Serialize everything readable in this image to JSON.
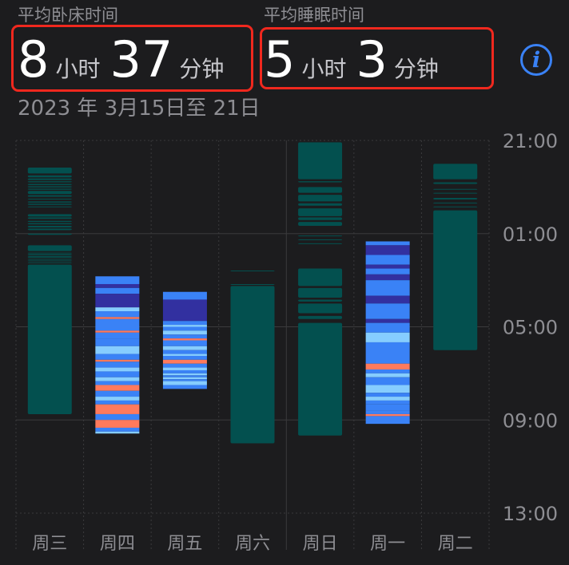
{
  "summary": {
    "in_bed": {
      "label": "平均卧床时间",
      "hours": "8",
      "hours_unit": "小时",
      "minutes": "37",
      "minutes_unit": "分钟"
    },
    "asleep": {
      "label": "平均睡眠时间",
      "hours": "5",
      "hours_unit": "小时",
      "minutes": "3",
      "minutes_unit": "分钟"
    },
    "date_range": "2023 年 3月15日至 21日"
  },
  "colors": {
    "background": "#1c1c1e",
    "grid": "#3a3a3c",
    "in_bed": "#03504f",
    "highlight_box": "#f0281e",
    "info": "#3a82f6",
    "deep": "#3230a0",
    "core": "#3a82f6",
    "rem": "#86cdff",
    "awake": "#ff7a5c"
  },
  "icons": {
    "info": "info-icon"
  },
  "chart_data": {
    "type": "bar",
    "title": "",
    "xlabel": "",
    "ylabel": "",
    "categories": [
      "周三",
      "周四",
      "周五",
      "周六",
      "周日",
      "周一",
      "周二"
    ],
    "y_ticks": [
      "21:00",
      "01:00",
      "05:00",
      "09:00",
      "13:00"
    ],
    "ylim": [
      "21:00",
      "13:00"
    ],
    "grid": true,
    "legend": "none",
    "series": [
      {
        "kind": "in_bed",
        "values": [
          [
            [
              "22:10",
              "22:25"
            ],
            [
              "22:30",
              "22:35"
            ],
            [
              "22:38",
              "22:42"
            ],
            [
              "22:45",
              "22:48"
            ],
            [
              "22:52",
              "22:55"
            ],
            [
              "22:58",
              "23:01"
            ],
            [
              "23:04",
              "23:07"
            ],
            [
              "23:10",
              "23:18"
            ],
            [
              "23:21",
              "23:25"
            ],
            [
              "23:30",
              "23:32"
            ],
            [
              "23:37",
              "23:40"
            ],
            [
              "23:43",
              "23:46"
            ],
            [
              "23:50",
              "23:52"
            ],
            [
              "00:10",
              "00:16"
            ],
            [
              "00:18",
              "00:22"
            ],
            [
              "00:27",
              "00:30"
            ],
            [
              "00:33",
              "00:36"
            ],
            [
              "00:40",
              "00:44"
            ],
            [
              "00:47",
              "00:51"
            ],
            [
              "01:00",
              "01:03"
            ],
            [
              "01:30",
              "01:45"
            ],
            [
              "01:49",
              "01:51"
            ],
            [
              "01:53",
              "01:56"
            ],
            [
              "01:58",
              "02:02"
            ],
            [
              "02:05",
              "02:07"
            ],
            [
              "02:09",
              "02:11"
            ],
            [
              "02:14",
              "02:16"
            ],
            [
              "02:20",
              "08:45"
            ]
          ],
          [],
          [],
          [
            [
              "02:35",
              "02:36"
            ],
            [
              "03:10",
              "03:12"
            ],
            [
              "03:15",
              "10:00"
            ]
          ],
          [
            [
              "21:05",
              "22:40"
            ],
            [
              "22:45",
              "22:48"
            ],
            [
              "23:00",
              "23:15"
            ],
            [
              "23:20",
              "23:37"
            ],
            [
              "23:42",
              "23:48"
            ],
            [
              "23:55",
              "00:15"
            ],
            [
              "00:18",
              "00:25"
            ],
            [
              "00:30",
              "00:40"
            ],
            [
              "01:05",
              "01:07"
            ],
            [
              "01:15",
              "01:17"
            ],
            [
              "01:25",
              "01:27"
            ],
            [
              "02:30",
              "03:15"
            ],
            [
              "03:20",
              "03:45"
            ],
            [
              "03:50",
              "03:55"
            ],
            [
              "04:00",
              "04:25"
            ],
            [
              "04:32",
              "04:40"
            ],
            [
              "04:50",
              "09:40"
            ]
          ],
          [],
          [
            [
              "22:00",
              "22:40"
            ],
            [
              "22:48",
              "22:52"
            ],
            [
              "23:05",
              "23:07"
            ],
            [
              "23:15",
              "23:17"
            ],
            [
              "23:28",
              "23:32"
            ],
            [
              "23:40",
              "23:42"
            ],
            [
              "23:50",
              "23:52"
            ],
            [
              "00:00",
              "06:00"
            ]
          ]
        ]
      },
      {
        "kind": "stages",
        "values": [
          [],
          [
            [
              "02:50",
              "03:10",
              "core"
            ],
            [
              "03:10",
              "03:20",
              "deep"
            ],
            [
              "03:20",
              "03:35",
              "core"
            ],
            [
              "03:35",
              "04:10",
              "deep"
            ],
            [
              "04:10",
              "04:20",
              "rem"
            ],
            [
              "04:20",
              "04:35",
              "core"
            ],
            [
              "04:35",
              "04:40",
              "awake"
            ],
            [
              "04:40",
              "05:10",
              "core"
            ],
            [
              "05:10",
              "05:15",
              "awake"
            ],
            [
              "05:15",
              "05:30",
              "core"
            ],
            [
              "05:30",
              "05:50",
              "core"
            ],
            [
              "05:50",
              "06:10",
              "rem"
            ],
            [
              "06:10",
              "06:25",
              "core"
            ],
            [
              "06:25",
              "06:30",
              "awake"
            ],
            [
              "06:30",
              "06:45",
              "core"
            ],
            [
              "06:45",
              "06:55",
              "rem"
            ],
            [
              "06:55",
              "07:10",
              "core"
            ],
            [
              "07:10",
              "07:20",
              "rem"
            ],
            [
              "07:20",
              "07:30",
              "core"
            ],
            [
              "07:30",
              "07:45",
              "awake"
            ],
            [
              "07:45",
              "08:00",
              "core"
            ],
            [
              "08:00",
              "08:10",
              "rem"
            ],
            [
              "08:10",
              "08:20",
              "core"
            ],
            [
              "08:20",
              "08:45",
              "awake"
            ],
            [
              "08:45",
              "09:00",
              "core"
            ],
            [
              "09:00",
              "09:20",
              "awake"
            ],
            [
              "09:20",
              "09:30",
              "core"
            ],
            [
              "09:30",
              "09:35",
              "rem"
            ]
          ],
          [
            [
              "03:30",
              "03:50",
              "core"
            ],
            [
              "03:50",
              "04:45",
              "deep"
            ],
            [
              "04:45",
              "04:55",
              "core"
            ],
            [
              "04:55",
              "05:00",
              "rem"
            ],
            [
              "05:00",
              "05:10",
              "core"
            ],
            [
              "05:10",
              "05:20",
              "rem"
            ],
            [
              "05:20",
              "05:30",
              "core"
            ],
            [
              "05:30",
              "05:35",
              "awake"
            ],
            [
              "05:35",
              "05:50",
              "core"
            ],
            [
              "05:50",
              "06:00",
              "rem"
            ],
            [
              "06:00",
              "06:10",
              "core"
            ],
            [
              "06:10",
              "06:15",
              "rem"
            ],
            [
              "06:15",
              "06:25",
              "core"
            ],
            [
              "06:25",
              "06:35",
              "awake"
            ],
            [
              "06:35",
              "06:45",
              "core"
            ],
            [
              "06:45",
              "06:52",
              "rem"
            ],
            [
              "06:52",
              "07:00",
              "core"
            ],
            [
              "07:00",
              "07:05",
              "rem"
            ],
            [
              "07:05",
              "07:10",
              "core"
            ],
            [
              "07:10",
              "07:15",
              "rem"
            ],
            [
              "07:15",
              "07:20",
              "core"
            ],
            [
              "07:20",
              "07:30",
              "rem"
            ],
            [
              "07:30",
              "07:40",
              "core"
            ]
          ],
          [],
          [],
          [
            [
              "01:20",
              "01:30",
              "core"
            ],
            [
              "01:30",
              "01:55",
              "deep"
            ],
            [
              "01:55",
              "02:20",
              "core"
            ],
            [
              "02:20",
              "02:30",
              "deep"
            ],
            [
              "02:30",
              "02:45",
              "core"
            ],
            [
              "02:45",
              "03:00",
              "deep"
            ],
            [
              "03:00",
              "03:40",
              "core"
            ],
            [
              "03:40",
              "04:00",
              "deep"
            ],
            [
              "04:00",
              "04:40",
              "core"
            ],
            [
              "04:40",
              "04:50",
              "deep"
            ],
            [
              "04:50",
              "05:15",
              "core"
            ],
            [
              "05:15",
              "05:40",
              "rem"
            ],
            [
              "05:40",
              "06:35",
              "core"
            ],
            [
              "06:35",
              "06:50",
              "awake"
            ],
            [
              "06:50",
              "07:00",
              "core"
            ],
            [
              "07:00",
              "07:10",
              "rem"
            ],
            [
              "07:10",
              "07:30",
              "core"
            ],
            [
              "07:30",
              "07:50",
              "rem"
            ],
            [
              "07:50",
              "08:00",
              "core"
            ],
            [
              "08:00",
              "08:10",
              "rem"
            ],
            [
              "08:10",
              "08:20",
              "core"
            ],
            [
              "08:20",
              "08:35",
              "core"
            ],
            [
              "08:35",
              "08:45",
              "core"
            ],
            [
              "08:45",
              "08:50",
              "awake"
            ],
            [
              "08:50",
              "09:10",
              "core"
            ]
          ],
          []
        ]
      }
    ]
  }
}
